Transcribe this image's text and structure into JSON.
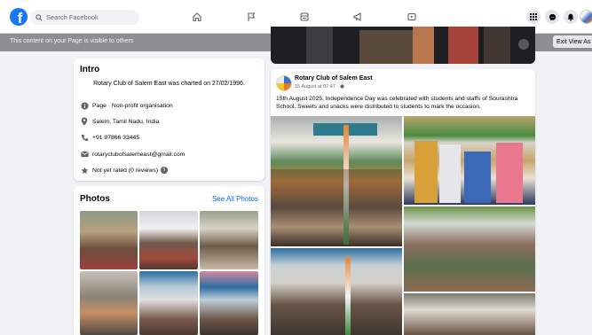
{
  "topnav": {
    "search_placeholder": "Search Facebook",
    "logo_letter": "f",
    "icons": [
      "home-icon",
      "flag-icon",
      "video-icon",
      "megaphone-icon",
      "gaming-icon"
    ],
    "right_icons": [
      "menu-grid-icon",
      "messenger-icon",
      "bell-icon"
    ]
  },
  "banner": {
    "text": "This content on your Page is visible to others",
    "exit_label": "Exit View As"
  },
  "intro": {
    "title": "Intro",
    "description": "Rotary Club of Salem East was charted on 27/02/1996.",
    "items": [
      {
        "icon": "info-icon",
        "label": "Page · Non-profit organisation",
        "bold": "Page"
      },
      {
        "icon": "location-pin-icon",
        "label": "Salem, Tamil Nadu, India"
      },
      {
        "icon": "phone-icon",
        "label": "+91 97866 33445"
      },
      {
        "icon": "email-icon",
        "label": "rotaryclubofsalemeast@gmail.com"
      },
      {
        "icon": "star-icon",
        "label": "Not yet rated (0 reviews)"
      }
    ]
  },
  "photos": {
    "title": "Photos",
    "see_all": "See All Photos"
  },
  "post": {
    "author": "Rotary Club of Salem East",
    "time": "15 August at 07:47 · ",
    "text": "15th August 2025, Independence Day was celebrated with students and staffs of Sourashtra School. Sweets and snacks were distributed to students to mark the occasion."
  },
  "colors": {
    "brand": "#1877f2",
    "link": "#0866ff",
    "banner": "#8c8e91",
    "background": "#f0f2f5"
  }
}
